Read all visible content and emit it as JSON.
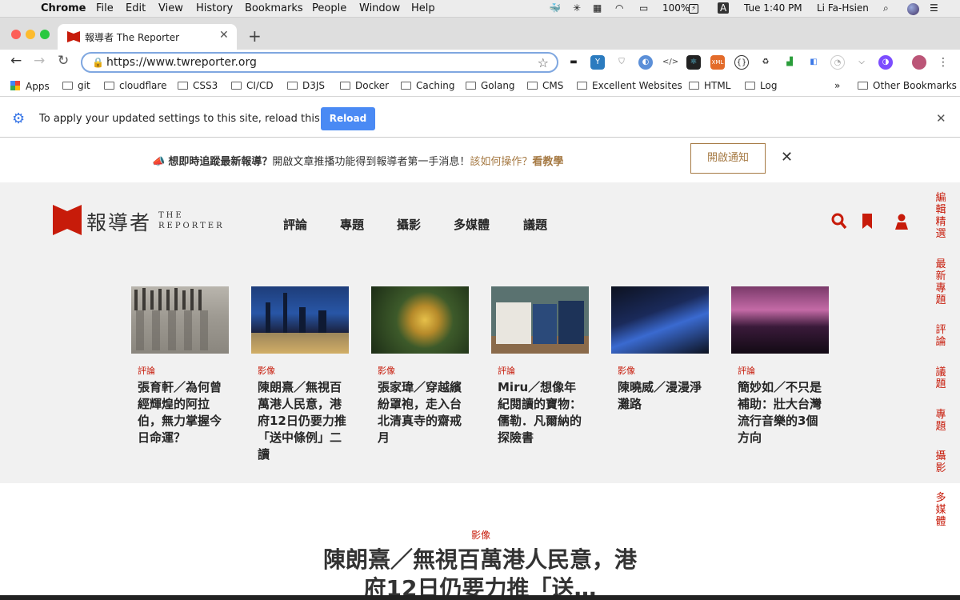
{
  "menubar": {
    "app": "Chrome",
    "items": [
      "File",
      "Edit",
      "View",
      "History",
      "Bookmarks",
      "People",
      "Window",
      "Help"
    ],
    "battery": "100%",
    "input_source": "A",
    "clock": "Tue 1:40 PM",
    "user": "Li Fa-Hsien"
  },
  "tab": {
    "title": "報導者 The Reporter",
    "close": "✕",
    "new_tab": "+"
  },
  "omnibox": {
    "url": "https://www.twreporter.org"
  },
  "bookmarks": {
    "items": [
      "Apps",
      "git",
      "cloudflare",
      "CSS3",
      "CI/CD",
      "D3JS",
      "Docker",
      "Caching",
      "Golang",
      "CMS",
      "Excellent Websites",
      "HTML",
      "Log"
    ],
    "overflow": "»",
    "other": "Other Bookmarks"
  },
  "infobar": {
    "message": "To apply your updated settings to this site, reload this page",
    "button": "Reload"
  },
  "notification": {
    "bold": "想即時追蹤最新報導？",
    "text": "開啟文章推播功能得到報導者第一手消息！",
    "link": "該如何操作？",
    "link2": "看教學",
    "button": "開啟通知"
  },
  "site": {
    "logo_zh": "報導者",
    "logo_en_1": "THE",
    "logo_en_2": "REPORTER",
    "nav": [
      "評論",
      "專題",
      "攝影",
      "多媒體",
      "議題"
    ],
    "rail": [
      "編輯精選",
      "最新專題",
      "評論",
      "議題",
      "專題",
      "攝影",
      "多媒體"
    ]
  },
  "cards": [
    {
      "category": "評論",
      "title": "張育軒／為何曾經輝煌的阿拉伯，無力掌握今日命運？"
    },
    {
      "category": "影像",
      "title": "陳朗熹／無視百萬港人民意，港府12日仍要力推「送中條例」二讀"
    },
    {
      "category": "影像",
      "title": "張家瑋／穿越繽紛罩袍，走入台北清真寺的齋戒月"
    },
    {
      "category": "評論",
      "title": "Miru／想像年紀閱讀的寶物：儒勒．凡爾納的探險書"
    },
    {
      "category": "影像",
      "title": "陳曉威／漫漫淨灘路"
    },
    {
      "category": "評論",
      "title": "簡妙如／不只是補助：壯大台灣流行音樂的3個方向"
    }
  ],
  "lead": {
    "category": "影像",
    "title": "陳朗熹／無視百萬港人民意，港府12日仍要力推「送…"
  },
  "colors": {
    "brand_red": "#c71b0a",
    "gold": "#a67a44",
    "reload_blue": "#4a8af4"
  }
}
